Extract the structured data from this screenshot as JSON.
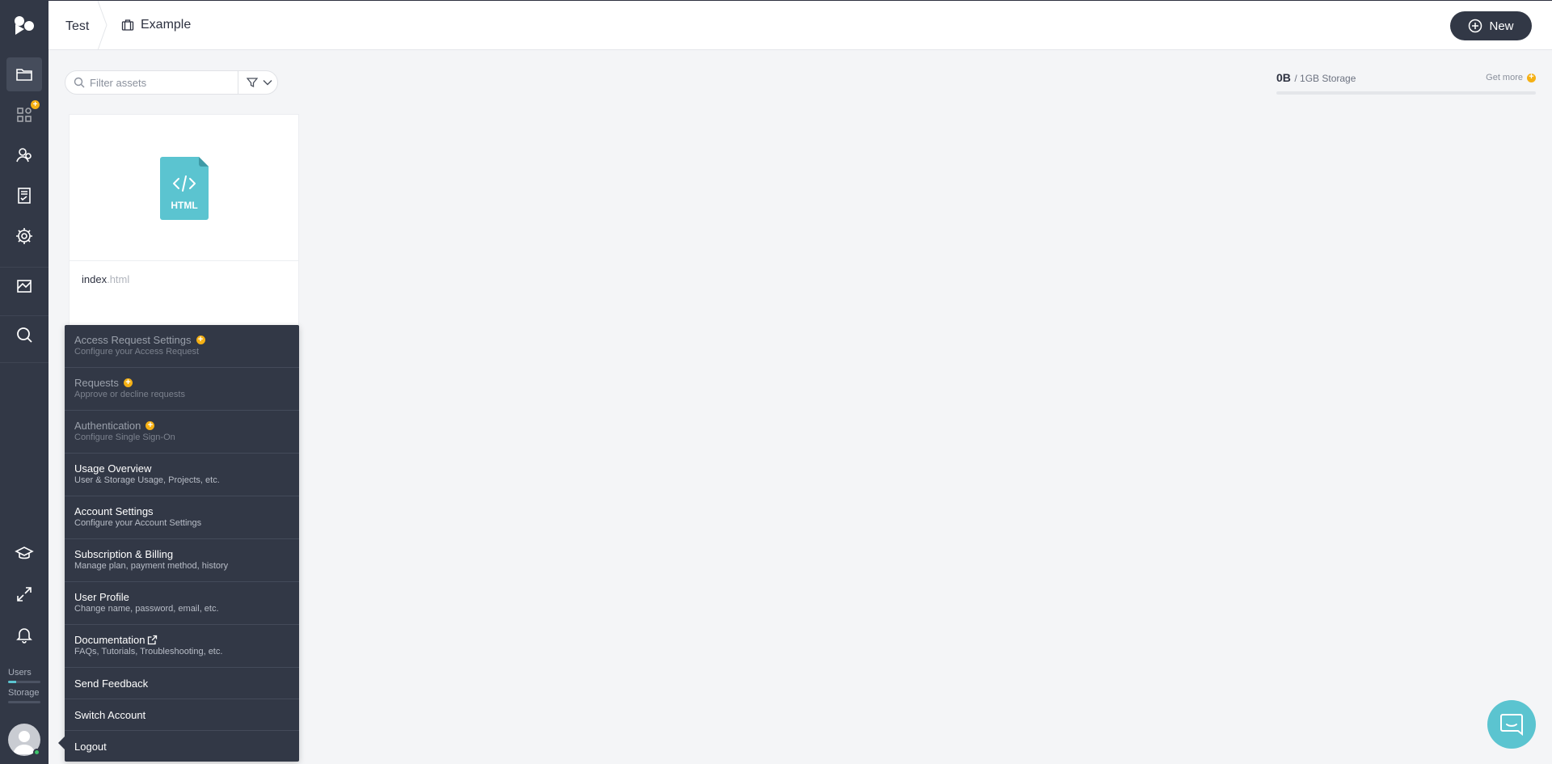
{
  "colors": {
    "sidebar": "#323846",
    "accent": "#5bc4d0",
    "badge": "#f5b014",
    "online": "#3cc36a"
  },
  "sidebar": {
    "items": [
      {
        "icon": "folder-icon",
        "active": true
      },
      {
        "icon": "apps-icon",
        "badge": true
      },
      {
        "icon": "users-icon"
      },
      {
        "icon": "checklist-icon"
      },
      {
        "icon": "gear-icon"
      },
      {
        "icon": "edit-board-icon"
      },
      {
        "icon": "search-icon"
      },
      {
        "icon": "graduation-cap-icon"
      },
      {
        "icon": "expand-icon"
      },
      {
        "icon": "bell-icon"
      }
    ],
    "users_label": "Users",
    "users_fill": 0.25,
    "storage_label": "Storage",
    "storage_fill": 0
  },
  "header": {
    "crumb_root": "Test",
    "crumb_project": "Example",
    "new_label": "New"
  },
  "filter": {
    "placeholder": "Filter assets"
  },
  "storage": {
    "used": "0B",
    "total": "/ 1GB Storage",
    "get_more": "Get more",
    "fill": 0
  },
  "asset": {
    "name": "index",
    "ext": ".html",
    "type_label": "HTML"
  },
  "menu": {
    "items": [
      {
        "title": "Access Request Settings",
        "sub": "Configure your Access Request",
        "disabled": true,
        "badge": true
      },
      {
        "title": "Requests",
        "sub": "Approve or decline requests",
        "disabled": true,
        "badge": true
      },
      {
        "title": "Authentication",
        "sub": "Configure Single Sign-On",
        "disabled": true,
        "badge": true
      },
      {
        "title": "Usage Overview",
        "sub": "User & Storage Usage, Projects, etc."
      },
      {
        "title": "Account Settings",
        "sub": "Configure your Account Settings"
      },
      {
        "title": "Subscription & Billing",
        "sub": "Manage plan, payment method, history"
      },
      {
        "title": "User Profile",
        "sub": "Change name, password, email, etc."
      },
      {
        "title": "Documentation",
        "sub": "FAQs, Tutorials, Troubleshooting, etc.",
        "external": true
      },
      {
        "title": "Send Feedback"
      },
      {
        "title": "Switch Account"
      },
      {
        "title": "Logout"
      }
    ]
  }
}
